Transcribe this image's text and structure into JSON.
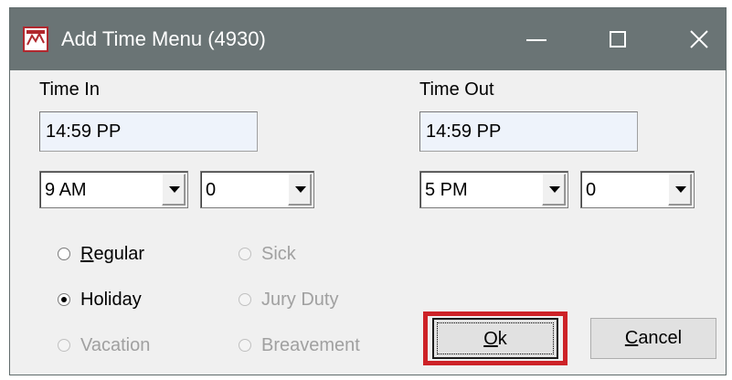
{
  "window": {
    "title": "Add Time Menu (4930)"
  },
  "time_in": {
    "label": "Time In",
    "value": "14:59 PP",
    "hour_selected": "9 AM",
    "minute_selected": "0"
  },
  "time_out": {
    "label": "Time Out",
    "value": "14:59 PP",
    "hour_selected": "5 PM",
    "minute_selected": "0"
  },
  "time_type": {
    "options": [
      {
        "key": "R",
        "rest": "egular",
        "label": "Regular",
        "checked": false,
        "enabled": true
      },
      {
        "label": "Holiday",
        "checked": true,
        "enabled": true
      },
      {
        "label": "Vacation",
        "checked": false,
        "enabled": false
      },
      {
        "label": "Sick",
        "checked": false,
        "enabled": false
      },
      {
        "label": "Jury Duty",
        "checked": false,
        "enabled": false
      },
      {
        "label": "Breavement",
        "checked": false,
        "enabled": false
      }
    ]
  },
  "buttons": {
    "ok": {
      "key": "O",
      "rest": "k"
    },
    "cancel": {
      "key": "C",
      "rest": "ancel"
    }
  },
  "colors": {
    "titlebar": "#6a7475",
    "highlight": "#cd2227",
    "textbox_bg": "#eef3fb"
  },
  "icons": {
    "app": "app-logo-icon",
    "minimize": "minimize-icon",
    "maximize": "maximize-icon",
    "close": "close-icon",
    "dropdown": "chevron-down-icon"
  }
}
